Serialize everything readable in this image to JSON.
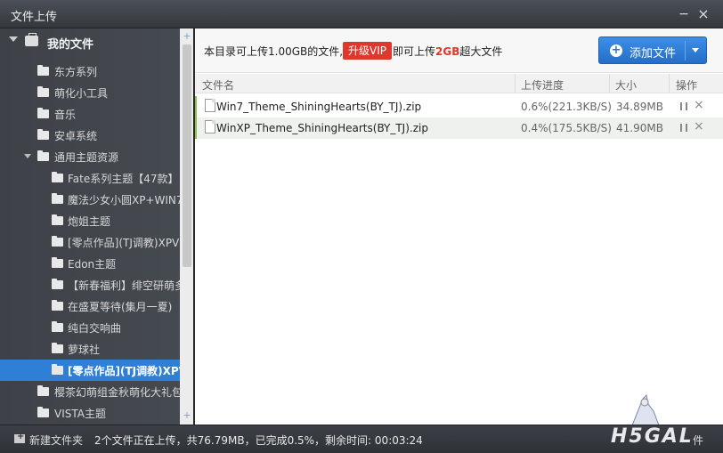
{
  "window": {
    "title": "文件上传",
    "minimize": "−",
    "close": "×"
  },
  "sidebar": {
    "root_label": "我的文件",
    "items": [
      {
        "label": "东方系列",
        "level": 1
      },
      {
        "label": "萌化小工具",
        "level": 1
      },
      {
        "label": "音乐",
        "level": 1
      },
      {
        "label": "安卓系统",
        "level": 1
      },
      {
        "label": "通用主题资源",
        "level": 1,
        "expanded": true
      },
      {
        "label": "Fate系列主题【47款】",
        "level": 2
      },
      {
        "label": "魔法少女小圆XP+WIN7",
        "level": 2
      },
      {
        "label": "炮姐主题",
        "level": 2
      },
      {
        "label": "[零点作品](TJ调教)XPV",
        "level": 2
      },
      {
        "label": "Edon主题",
        "level": 2
      },
      {
        "label": "【新春福利】绯空研萌多",
        "level": 2
      },
      {
        "label": "在盛夏等待(集月一夏)",
        "level": 2
      },
      {
        "label": "纯白交响曲",
        "level": 2
      },
      {
        "label": "萝球社",
        "level": 2
      },
      {
        "label": "[零点作品](TJ调教)XPV",
        "level": 2,
        "selected": true
      },
      {
        "label": "樱茶幻萌组金秋萌化大礼包",
        "level": 1
      },
      {
        "label": "VISTA主题",
        "level": 1
      }
    ]
  },
  "infobar": {
    "text_before": "本目录可上传1.00GB的文件,",
    "vip_button": "升级VIP",
    "text_after_pre": "即可上传",
    "text_after_hl": "2GB",
    "text_after_post": "超大文件",
    "add_button": "添加文件"
  },
  "table": {
    "headers": {
      "name": "文件名",
      "progress": "上传进度",
      "size": "大小",
      "action": "操作"
    },
    "rows": [
      {
        "name": "Win7_Theme_ShiningHearts(BY_TJ).zip",
        "progress": "0.6%(221.3KB/S)",
        "size": "34.89MB"
      },
      {
        "name": "WinXP_Theme_ShiningHearts(BY_TJ).zip",
        "progress": "0.4%(175.5KB/S)",
        "size": "41.90MB"
      }
    ]
  },
  "status": {
    "new_folder": "新建文件夹",
    "summary": "2个文件正在上传，共76.79MB，已完成0.5%，剩余时间: 00:03:24",
    "watermark": "H5GAL",
    "trailing": "件"
  },
  "colors": {
    "accent": "#2f7fd6",
    "vip": "#e0372d",
    "row_marker": "#8bc34a"
  }
}
